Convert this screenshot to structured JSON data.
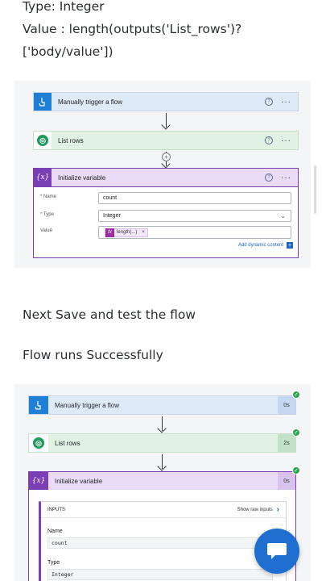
{
  "article": {
    "type_line": "Type: Integer",
    "value_line": "Value : length(outputs('List_rows')?['body/value'])",
    "save_line": "Next Save and test the flow",
    "success_line": "Flow runs Successfully"
  },
  "flow_editor": {
    "trigger": {
      "label": "Manually trigger a flow",
      "help_icon": "?",
      "more_icon": "···"
    },
    "list_rows": {
      "label": "List rows",
      "help_icon": "?",
      "more_icon": "···"
    },
    "insert_step_icon": "+",
    "init_variable": {
      "icon_text": "{x}",
      "label": "Initialize variable",
      "help_icon": "?",
      "more_icon": "···",
      "name_label": "* Name",
      "name_value": "count",
      "type_label": "* Type",
      "type_value": "Integer",
      "value_label": "Value",
      "fx_icon": "fx",
      "expression_token": "length(...)",
      "token_remove": "×",
      "add_dynamic_content": "Add dynamic content",
      "add_dynamic_icon": "+"
    }
  },
  "run_history": {
    "trigger": {
      "label": "Manually trigger a flow",
      "duration": "0s",
      "status": "success"
    },
    "list_rows": {
      "label": "List rows",
      "duration": "2s",
      "status": "success"
    },
    "init_variable": {
      "icon_text": "{x}",
      "label": "Initialize variable",
      "duration": "0s",
      "status": "success",
      "inputs_header": "INPUTS",
      "show_raw_inputs": "Show raw inputs",
      "name_label": "Name",
      "name_value": "count",
      "type_label": "Type",
      "type_value": "Integer"
    },
    "check_icon": "✓"
  },
  "colors": {
    "trigger_blue": "#1f7ed6",
    "dataverse_green": "#1e9b5a",
    "variable_purple": "#7b3fb5",
    "success_green": "#2da44e",
    "chat_fab_blue": "#1e6fd0"
  }
}
